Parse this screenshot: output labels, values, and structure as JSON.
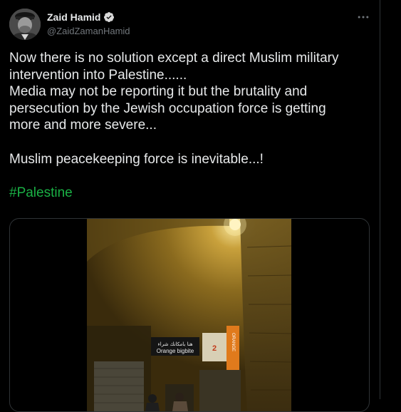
{
  "tweet": {
    "author": {
      "display_name": "Zaid Hamid",
      "handle": "@ZaidZamanHamid",
      "verified": true,
      "avatar_icon": "profile-photo"
    },
    "more_icon": "more-horizontal-icon",
    "lines_block1": [
      "Now there is no solution except a direct Muslim military",
      "intervention into Palestine......",
      "Media may not be reporting it but the brutality and",
      "persecution by the Jewish occupation force is getting",
      "more and more severe..."
    ],
    "line_block2": "Muslim peacekeeping force is inevitable...!",
    "hashtag": "#Palestine",
    "media": {
      "type": "video",
      "shop_sign_text": "Orange bigbite",
      "shop_sign_arabic": "هنا بامكانك شراء",
      "vertical_sign_text": "ORANGE"
    }
  },
  "colors": {
    "background": "#000000",
    "text": "#e7e9ea",
    "secondary_text": "#71767b",
    "hashtag": "#1ab045",
    "verified": "#d9d9d9",
    "border": "#2f3336"
  }
}
